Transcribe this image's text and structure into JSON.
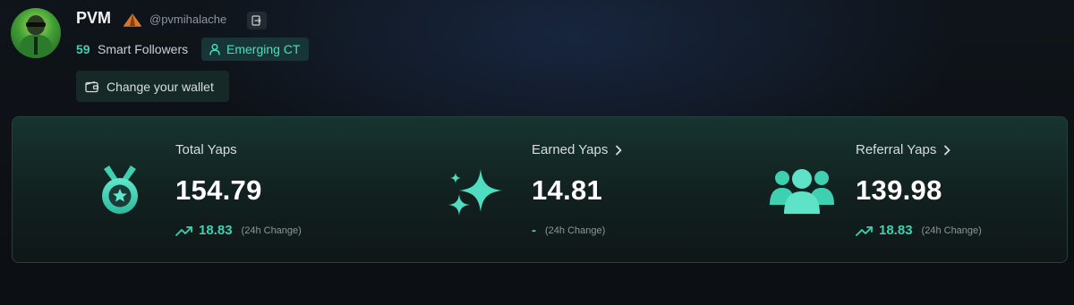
{
  "profile": {
    "name": "PVM",
    "handle": "@pvmihalache",
    "smart_followers_count": "59",
    "smart_followers_label": "Smart Followers",
    "tier_badge": "Emerging CT",
    "wallet_button": "Change your wallet"
  },
  "stats": [
    {
      "label": "Total Yaps",
      "value": "154.79",
      "change": "18.83",
      "change_note": "(24h Change)",
      "trend": "up",
      "icon": "medal-star-icon"
    },
    {
      "label": "Earned Yaps",
      "value": "14.81",
      "change": "-",
      "change_note": "(24h Change)",
      "trend": "none",
      "icon": "sparkles-icon"
    },
    {
      "label": "Referral Yaps",
      "value": "139.98",
      "change": "18.83",
      "change_note": "(24h Change)",
      "trend": "up",
      "icon": "users-group-icon"
    }
  ],
  "colors": {
    "accent": "#3fd0b1",
    "card_bg": "#173430",
    "page_bg": "#0d1116"
  }
}
